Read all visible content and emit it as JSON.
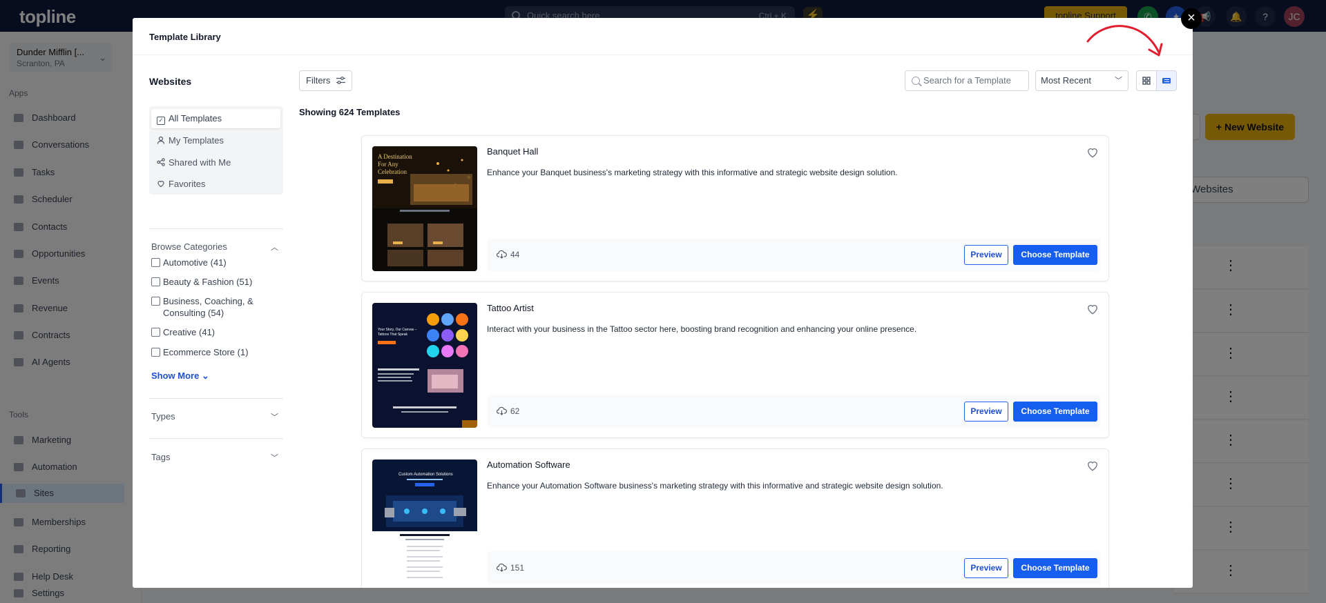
{
  "app": {
    "logo": "topline",
    "search_placeholder": "Quick search here",
    "search_shortcut": "Ctrl + K",
    "support_label": "topline Support",
    "avatar_initials": "JC",
    "help_label": "?"
  },
  "sidebar": {
    "account_name": "Dunder Mifflin [...",
    "account_location": "Scranton, PA",
    "apps_heading": "Apps",
    "tools_heading": "Tools",
    "apps": [
      "Dashboard",
      "Conversations",
      "Tasks",
      "Scheduler",
      "Contacts",
      "Opportunities",
      "Events",
      "Revenue",
      "Contracts",
      "AI Agents"
    ],
    "tools": [
      "Marketing",
      "Automation",
      "Sites",
      "Memberships",
      "Reporting",
      "Help Desk",
      "Settings"
    ],
    "active_item": "Sites"
  },
  "background": {
    "new_website_label": "+ New Website",
    "your_websites_label": "r Websites"
  },
  "modal": {
    "title": "Template Library",
    "close_label": "×",
    "left_panel": {
      "title": "Websites",
      "nav": [
        {
          "label": "All Templates",
          "icon": "checkbox-icon"
        },
        {
          "label": "My Templates",
          "icon": "user-icon"
        },
        {
          "label": "Shared with Me",
          "icon": "share-icon"
        },
        {
          "label": "Favorites",
          "icon": "heart-icon"
        }
      ],
      "browse_categories_label": "Browse Categories",
      "categories": [
        {
          "label": "Automotive (41)"
        },
        {
          "label": "Beauty & Fashion (51)"
        },
        {
          "label": "Business, Coaching, & Consulting (54)"
        },
        {
          "label": "Creative (41)"
        },
        {
          "label": "Ecommerce Store (1)"
        }
      ],
      "show_more_label": "Show More",
      "types_label": "Types",
      "tags_label": "Tags"
    },
    "toolbar": {
      "filters_label": "Filters",
      "search_placeholder": "Search for a Template",
      "sort_value": "Most Recent",
      "view_mode": "list"
    },
    "showing_label": "Showing 624 Templates",
    "templates": [
      {
        "title": "Banquet Hall",
        "description": "Enhance your Banquet business's marketing strategy with this informative and strategic website design solution.",
        "downloads": "44",
        "thumb_headline": "A Destination For Any Celebration"
      },
      {
        "title": "Tattoo Artist",
        "description": "Interact with your business in the Tattoo sector here, boosting brand recognition and enhancing your online presence.",
        "downloads": "62",
        "thumb_headline": "Your Story, Our Canvas – Tattoos That Speak"
      },
      {
        "title": "Automation Software",
        "description": "Enhance your Automation Software business's marketing strategy with this informative and strategic website design solution.",
        "downloads": "151",
        "thumb_headline": "Custom Automation Solutions"
      }
    ],
    "preview_label": "Preview",
    "choose_label": "Choose Template"
  },
  "colors": {
    "primary": "#155eef",
    "topbar": "#0f1b3d",
    "accent_yellow": "#eab308",
    "annotation_arrow": "#e11d2e"
  }
}
